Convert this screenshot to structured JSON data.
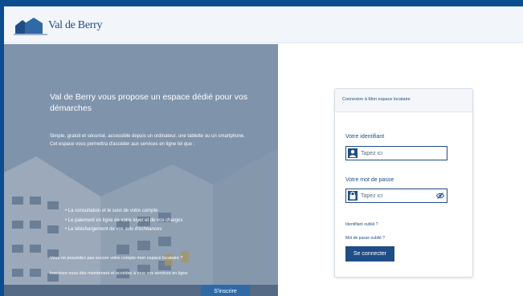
{
  "header": {
    "logo_text": "Val de Berry"
  },
  "hero": {
    "title": "Val de Berry vous propose un espace dédié pour vos démarches",
    "text_1": "Simple, gratuit et sécurisé, accessible depuis un ordinateur, une tablette ou un smartphone.",
    "text_2": "Cet espace vous permettra d'accéder aux services en ligne tel que :",
    "items": [
      "• La consultation et le suivi de votre compte",
      "• Le paiement en ligne de votre loyer et de vos charges",
      "• Le téléchargement de vos avis d'échéances"
    ],
    "question": "Vous ne possédez pas encore votre compte mon espace locataire ?",
    "question_2": "Inscrivez-vous dès maintenant et accédez à tous vos services en ligne",
    "signup_label": "S'inscrire"
  },
  "login": {
    "card_title": "Connexion à Mon espace locataire",
    "id_label": "Votre identifiant",
    "id_placeholder": "Tapez ici",
    "password_label": "Votre mot de passe",
    "password_placeholder": "Tapez ici",
    "forgot_id": "Identifiant oublié ?",
    "forgot_password": "Mot de passe oublié ?",
    "submit_label": "Se connecter"
  },
  "colors": {
    "accent": "#1f4d86",
    "frame": "#0b4d8f",
    "signup_button": "#2f6aa7"
  }
}
